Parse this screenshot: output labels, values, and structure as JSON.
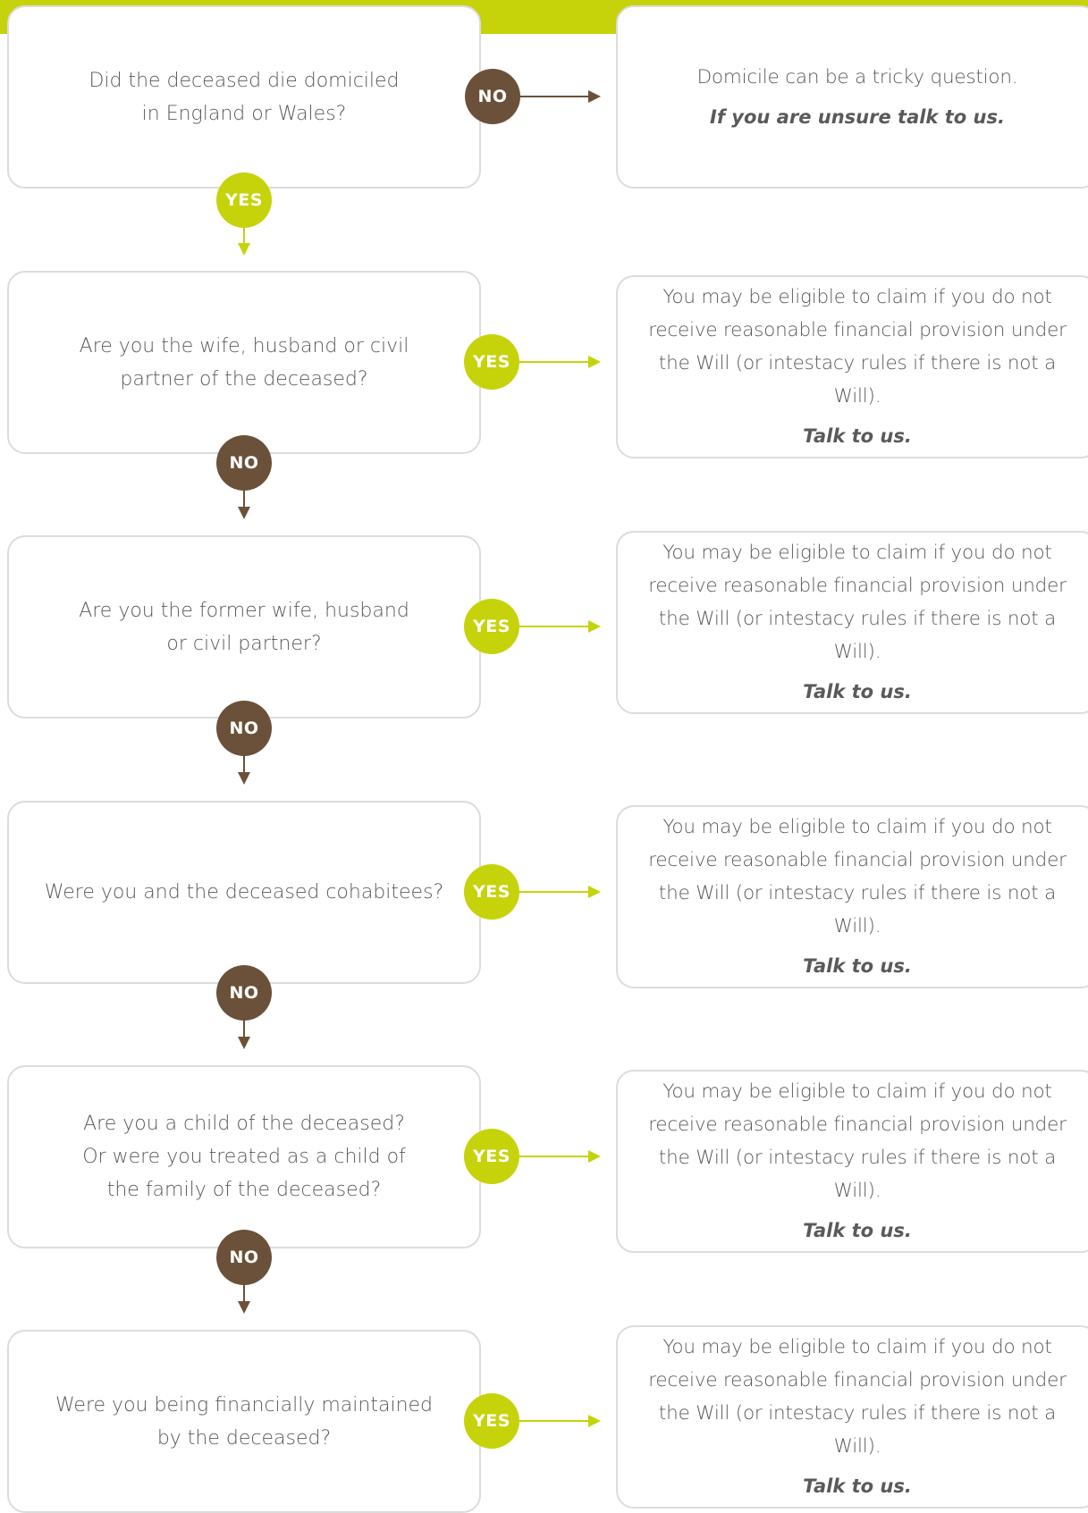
{
  "colors": {
    "accent_green": "#c6d30a",
    "accent_brown": "#6b5139",
    "border": "#dcdcdc",
    "text": "#5a5a5a"
  },
  "steps": [
    {
      "question": "Did the deceased die domiciled\nin England or Wales?",
      "side_label": "NO",
      "answer_body": "Domicile can be a tricky question.",
      "answer_cta": "If you are unsure talk to us.",
      "down_label": "YES"
    },
    {
      "question": "Are you the wife, husband or civil\npartner of the deceased?",
      "side_label": "YES",
      "answer_body": "You may be eligible to claim if you do not receive reasonable financial provision under the Will (or intestacy rules if there is not a Will).",
      "answer_cta": "Talk to us.",
      "down_label": "NO"
    },
    {
      "question": "Are you the former wife, husband\nor civil partner?",
      "side_label": "YES",
      "answer_body": "You may be eligible to claim if you do not receive reasonable financial provision under the Will (or intestacy rules if there is not a Will).",
      "answer_cta": "Talk to us.",
      "down_label": "NO"
    },
    {
      "question": "Were you and the deceased cohabitees?",
      "side_label": "YES",
      "answer_body": "You may be eligible to claim if you do not receive reasonable financial provision under the Will (or intestacy rules if there is not a Will).",
      "answer_cta": "Talk to us.",
      "down_label": "NO"
    },
    {
      "question": "Are you a child of the deceased?\nOr were you treated as a child of\nthe family of the deceased?",
      "side_label": "YES",
      "answer_body": "You may be eligible to claim if you do not receive reasonable financial provision under the Will (or intestacy rules if there is not a Will).",
      "answer_cta": "Talk to us.",
      "down_label": "NO"
    },
    {
      "question": "Were you being financially maintained\nby the deceased?",
      "side_label": "YES",
      "answer_body": "You may be eligible to claim if you do not receive reasonable financial provision under the Will (or intestacy rules if there is not a Will).",
      "answer_cta": "Talk to us."
    }
  ]
}
